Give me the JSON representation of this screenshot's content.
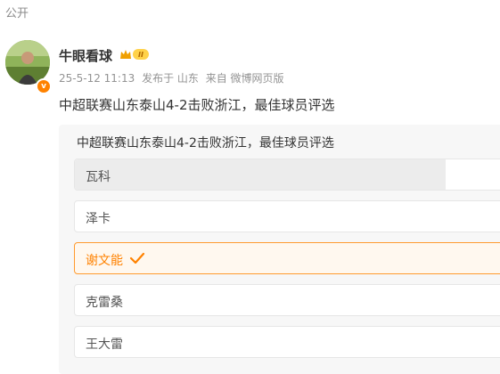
{
  "post": {
    "visibility": "公开",
    "author": {
      "name": "牛眼看球",
      "vip_level": "II"
    },
    "date": "25-5-12 11:13",
    "location_label": "发布于 山东",
    "source_label": "来自 微博网页版",
    "text": "中超联赛山东泰山4-2击败浙江，最佳球员评选"
  },
  "poll": {
    "title": "中超联赛山东泰山4-2击败浙江，最佳球员评选",
    "options": [
      {
        "label": "瓦科",
        "selected": false
      },
      {
        "label": "泽卡",
        "selected": false
      },
      {
        "label": "谢文能",
        "selected": true
      },
      {
        "label": "克雷桑",
        "selected": false
      },
      {
        "label": "王大雷",
        "selected": false
      }
    ]
  },
  "colors": {
    "accent": "#ff8200",
    "selected_border": "#ff9a2e",
    "muted": "#939393"
  }
}
